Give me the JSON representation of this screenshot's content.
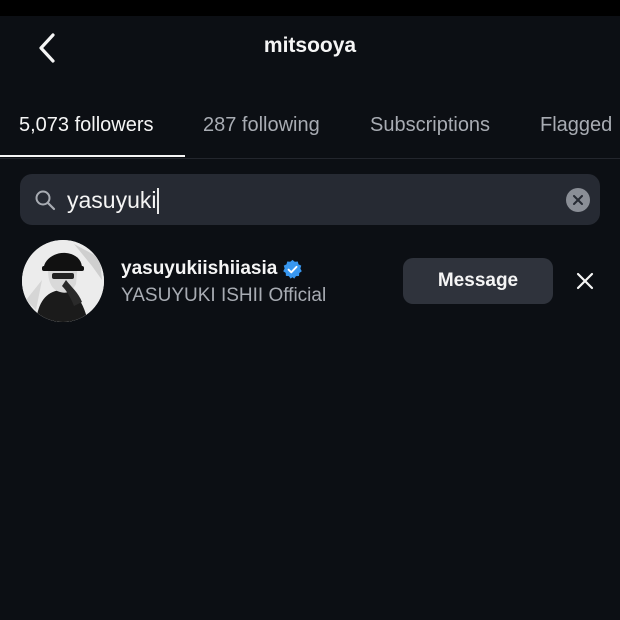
{
  "header": {
    "title": "mitsooya",
    "back_icon": "chevron-left-icon"
  },
  "tabs": [
    {
      "label": "5,073 followers",
      "active": true
    },
    {
      "label": "287 following",
      "active": false
    },
    {
      "label": "Subscriptions",
      "active": false
    },
    {
      "label": "Flagged",
      "active": false
    }
  ],
  "search": {
    "value": "yasuyuki",
    "icon": "search-icon",
    "clear_icon": "clear-icon"
  },
  "results": [
    {
      "username": "yasuyukiishiiasia",
      "full_name": "YASUYUKI ISHII Official",
      "verified": true,
      "message_label": "Message",
      "remove_icon": "close-icon"
    }
  ],
  "colors": {
    "background": "#0c0f14",
    "search_bg": "#262a33",
    "button_bg": "#2f333c",
    "verified_blue": "#3897f0",
    "muted_text": "#a8acb3"
  }
}
